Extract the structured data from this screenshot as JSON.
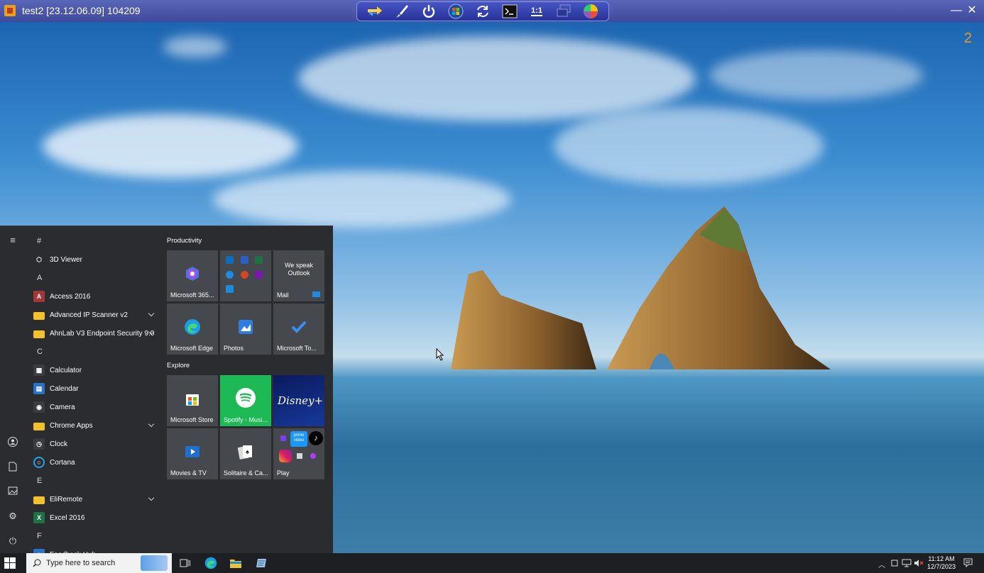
{
  "window": {
    "title": "test2 [23.12.06.09] 104209",
    "minimize_label": "—",
    "close_label": "✕"
  },
  "toolbar": {
    "zoom_label": "1:1"
  },
  "desktop": {
    "number": "2"
  },
  "start_menu": {
    "sections": [
      {
        "letter": "#",
        "apps": [
          {
            "name": "3D Viewer",
            "icon": "cube-icon",
            "color": "#2a2c2f",
            "chevron": false
          }
        ]
      },
      {
        "letter": "A",
        "apps": [
          {
            "name": "Access 2016",
            "icon": "access-icon",
            "color": "#a4373a",
            "chevron": false
          },
          {
            "name": "Advanced IP Scanner v2",
            "icon": "folder-icon",
            "color": "#f2c12e",
            "chevron": true
          },
          {
            "name": "AhnLab V3 Endpoint Security 9.0",
            "icon": "folder-icon",
            "color": "#f2c12e",
            "chevron": true
          }
        ]
      },
      {
        "letter": "C",
        "apps": [
          {
            "name": "Calculator",
            "icon": "calculator-icon",
            "color": "#3a3c40",
            "chevron": false
          },
          {
            "name": "Calendar",
            "icon": "calendar-icon",
            "color": "#2a72c8",
            "chevron": false
          },
          {
            "name": "Camera",
            "icon": "camera-icon",
            "color": "#3a3c40",
            "chevron": false
          },
          {
            "name": "Chrome Apps",
            "icon": "folder-icon",
            "color": "#f2c12e",
            "chevron": true
          },
          {
            "name": "Clock",
            "icon": "clock-icon",
            "color": "#3a3c40",
            "chevron": false
          },
          {
            "name": "Cortana",
            "icon": "cortana-icon",
            "color": "#2a2c2f",
            "chevron": false
          }
        ]
      },
      {
        "letter": "E",
        "apps": [
          {
            "name": "EliRemote",
            "icon": "folder-icon",
            "color": "#f2c12e",
            "chevron": true
          },
          {
            "name": "Excel 2016",
            "icon": "excel-icon",
            "color": "#1e7145",
            "chevron": false
          }
        ]
      },
      {
        "letter": "F",
        "apps": [
          {
            "name": "Feedback Hub",
            "icon": "feedback-icon",
            "color": "#2a72c8",
            "chevron": false
          }
        ]
      }
    ],
    "groups": [
      {
        "title": "Productivity",
        "tiles": [
          {
            "label": "Microsoft 365...",
            "name": "tile-microsoft-365"
          },
          {
            "label": "",
            "name": "tile-office-apps"
          },
          {
            "label": "Mail",
            "name": "tile-mail",
            "subtitle": "We speak Outlook"
          },
          {
            "label": "Microsoft Edge",
            "name": "tile-microsoft-edge"
          },
          {
            "label": "Photos",
            "name": "tile-photos"
          },
          {
            "label": "Microsoft To...",
            "name": "tile-microsoft-todo"
          }
        ]
      },
      {
        "title": "Explore",
        "tiles": [
          {
            "label": "Microsoft Store",
            "name": "tile-microsoft-store"
          },
          {
            "label": "Spotify - Musi...",
            "name": "tile-spotify"
          },
          {
            "label": "",
            "name": "tile-disney-plus",
            "brand": "Disney+"
          },
          {
            "label": "Movies & TV",
            "name": "tile-movies-tv"
          },
          {
            "label": "Solitaire & Ca...",
            "name": "tile-solitaire"
          },
          {
            "label": "Play",
            "name": "tile-play",
            "brand": "prime video"
          }
        ]
      }
    ]
  },
  "taskbar": {
    "search_placeholder": "Type here to search",
    "time": "11:12 AM",
    "date": "12/7/2023"
  }
}
